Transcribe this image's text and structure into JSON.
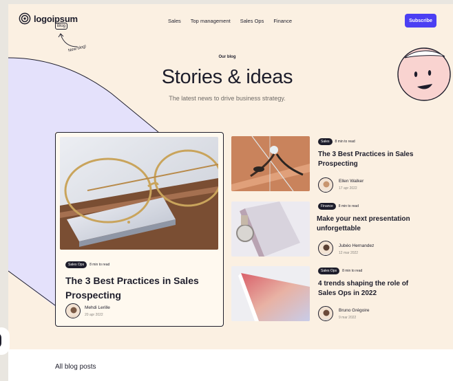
{
  "header": {
    "logo_text": "logoipsum",
    "blog_tag": "Blog",
    "new_blog_note": "New blog!",
    "nav": [
      "Sales",
      "Top management",
      "Sales Ops",
      "Finance"
    ],
    "subscribe_label": "Subscribe"
  },
  "hero": {
    "eyebrow": "Our blog",
    "title": "Stories & ideas",
    "subtitle": "The latest news to drive business strategy."
  },
  "featured": {
    "tag": "Sales Ops",
    "read_time": "8 min to read",
    "title": "The 3 Best Practices in Sales Prospecting",
    "author": "Mehdi Lerille",
    "date": "20 apr 2022"
  },
  "posts": [
    {
      "tag": "Sales",
      "read_time": "8 min to read",
      "title": "The 3 Best Practices in Sales Prospecting",
      "author": "Ellen Walker",
      "date": "17 apr 2022"
    },
    {
      "tag": "Finance",
      "read_time": "8 min to read",
      "title": "Make your next presentation unforgettable",
      "author": "Jubéo Hernandez",
      "date": "12 mar 2022"
    },
    {
      "tag": "Sales Ops",
      "read_time": "8 min to read",
      "title": "4 trends shaping the role of Sales Ops in 2022",
      "author": "Bruno Grégoire",
      "date": "9 mar 2022"
    }
  ],
  "footer": {
    "all_posts": "All blog posts"
  },
  "colors": {
    "accent": "#4b3ff3",
    "background": "#fbf0e2",
    "ink": "#1d1d2b",
    "lavender": "#e4e1fb",
    "smiley_face": "#f9d3d0"
  },
  "icons": [
    "logo-mark-icon",
    "curved-arrow-icon",
    "smiley-face-icon"
  ]
}
